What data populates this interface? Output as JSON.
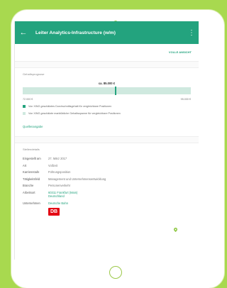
{
  "appbar": {
    "title": "Leiter Analytics-Infrastructure (w/m)",
    "back_icon": "arrow-left-icon",
    "more_icon": "more-vert-icon"
  },
  "full_view_label": "VOLLE ANSICHT",
  "salary": {
    "header": "Gehaltsprognose",
    "value_label": "ca. 85.000 €",
    "range_min": "72.000 €",
    "range_max": "95.000 €",
    "marker_fraction": 0.55,
    "legend": [
      {
        "label": "Von XING geschätztes Durchschnittsgehalt für vergleichbare Positionen",
        "color": "#23a37e"
      },
      {
        "label": "Von XING geschätzte marktübliche Gehaltsspanne für vergleichbare Positionen",
        "color": "#cfe9df"
      }
    ]
  },
  "sources_label": "Quellenangabe",
  "details": {
    "header": "Stellendetails",
    "rows": [
      {
        "label": "Eingestellt am",
        "value": "27. März 2017"
      },
      {
        "label": "Art",
        "value": "Vollzeit"
      },
      {
        "label": "Karrierestufe",
        "value": "Führungsposition"
      },
      {
        "label": "Tätigkeitsfeld",
        "value": "Management und Unternehmensentwicklung"
      },
      {
        "label": "Branche",
        "value": "Personenverkehr"
      },
      {
        "label": "Arbeitsort",
        "value": "60311 Frankfurt (Main)",
        "value2": "Deutschland"
      },
      {
        "label": "Unternehmen",
        "value": "Deutsche Bahn"
      }
    ],
    "logo_text": "DB"
  },
  "colors": {
    "accent": "#23a37e",
    "background": "#a8d94f",
    "logo_red": "#e30613"
  }
}
